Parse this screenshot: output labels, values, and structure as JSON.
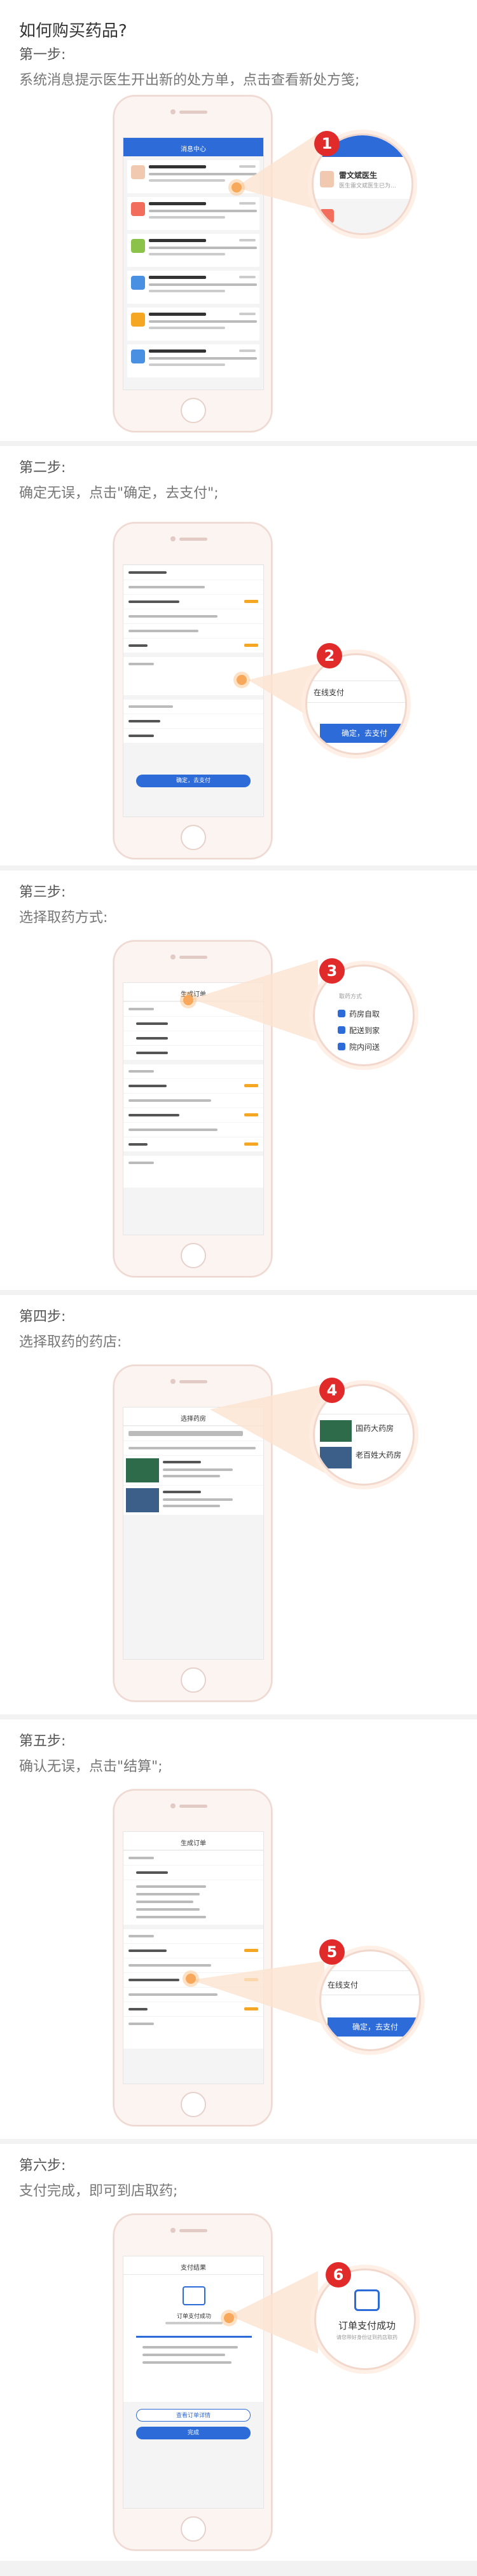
{
  "page_title": "如何购买药品?",
  "steps": [
    {
      "step_label": "第一步:",
      "description": "系统消息提示医生开出新的处方单，点击查看新处方笺;",
      "badge": "1",
      "screen_title": "消息中心",
      "zoom_texts": [
        "雷文斌医生",
        "医生雷文斌医生已为..."
      ]
    },
    {
      "step_label": "第二步:",
      "description": "确定无误，点击\"确定，去支付\";",
      "badge": "2",
      "screen_button": "确定，去支付",
      "zoom_texts": [
        "在线支付",
        "确定，去支付"
      ]
    },
    {
      "step_label": "第三步:",
      "description": "选择取药方式:",
      "badge": "3",
      "screen_title": "生成订单",
      "zoom_texts": [
        "取药方式",
        "药房自取",
        "配送到家",
        "院内问送"
      ]
    },
    {
      "step_label": "第四步:",
      "description": "选择取药的药店:",
      "badge": "4",
      "screen_title": "选择药房",
      "zoom_texts": [
        "国药大药房",
        "老百姓大药房"
      ]
    },
    {
      "step_label": "第五步:",
      "description": "确认无误，点击\"结算\";",
      "badge": "5",
      "screen_title": "生成订单",
      "zoom_texts": [
        "在线支付",
        "确定，去支付"
      ]
    },
    {
      "step_label": "第六步:",
      "description": "支付完成，即可到店取药;",
      "badge": "6",
      "screen_title": "支付结果",
      "screen_heading": "订单支付成功",
      "screen_buttons": [
        "查看订单详情",
        "完成"
      ],
      "zoom_texts": [
        "订单支付成功",
        "请您带好身份证到药店取药"
      ]
    }
  ],
  "colors": {
    "accent_blue": "#2d6bd8",
    "badge_red": "#e12b2b",
    "highlight_orange": "#f8a85a",
    "price_orange": "#f5a623"
  }
}
